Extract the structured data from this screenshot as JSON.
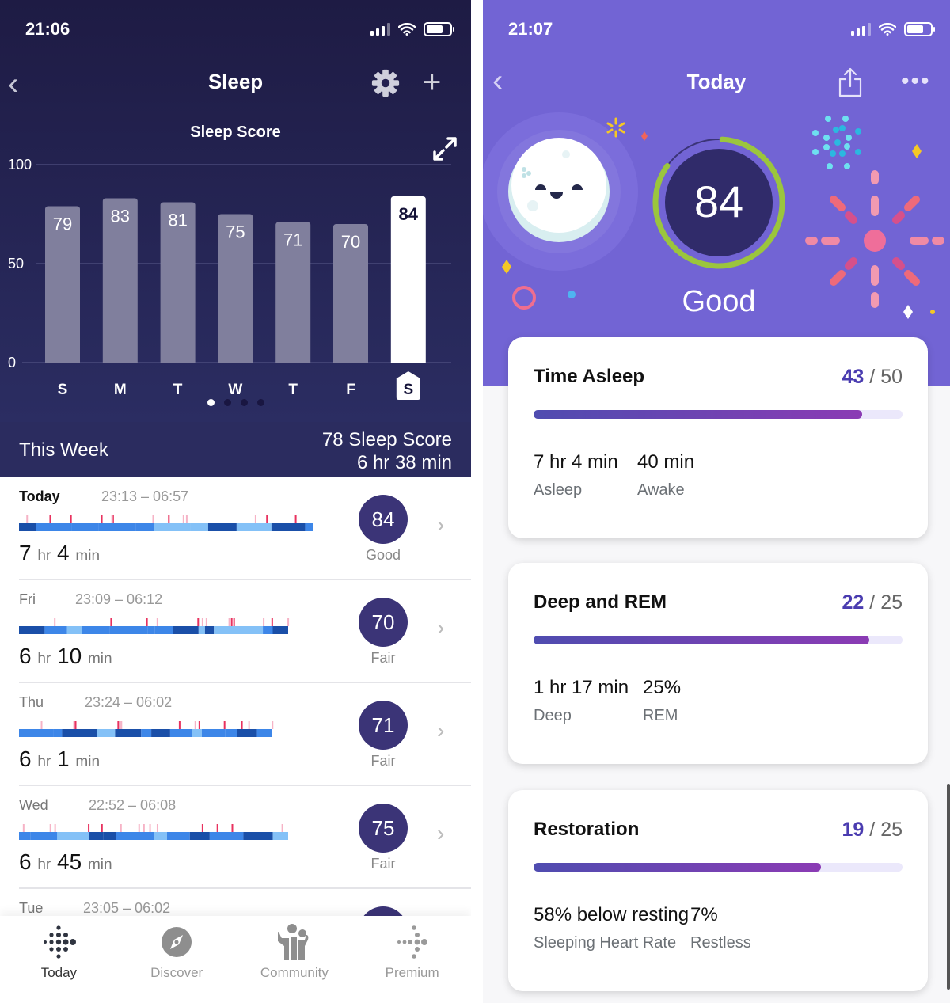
{
  "left": {
    "status": {
      "time": "21:06"
    },
    "nav": {
      "title": "Sleep",
      "back": "‹",
      "plus": "+"
    },
    "chart_title": "Sleep Score",
    "week": {
      "label": "This Week",
      "score": "78 Sleep Score",
      "duration": "6 hr 38 min"
    },
    "rows": [
      {
        "day": "Today",
        "range": "23:13 – 06:57",
        "hours": "7",
        "mins": "4",
        "score": "84",
        "quality": "Good"
      },
      {
        "day": "Fri",
        "range": "23:09 – 06:12",
        "hours": "6",
        "mins": "10",
        "score": "70",
        "quality": "Fair"
      },
      {
        "day": "Thu",
        "range": "23:24 – 06:02",
        "hours": "6",
        "mins": "1",
        "score": "71",
        "quality": "Fair"
      },
      {
        "day": "Wed",
        "range": "22:52 – 06:08",
        "hours": "6",
        "mins": "45",
        "score": "75",
        "quality": "Fair"
      },
      {
        "day": "Tue",
        "range": "23:05 – 06:02",
        "hours": "",
        "mins": "",
        "score": "",
        "quality": ""
      }
    ],
    "hr_unit": "hr",
    "min_unit": "min",
    "tabs": [
      {
        "label": "Today",
        "icon": "fitbit-logo-icon",
        "active": true
      },
      {
        "label": "Discover",
        "icon": "compass-icon",
        "active": false
      },
      {
        "label": "Community",
        "icon": "community-icon",
        "active": false
      },
      {
        "label": "Premium",
        "icon": "premium-icon",
        "active": false
      }
    ]
  },
  "right": {
    "status": {
      "time": "21:07"
    },
    "nav": {
      "title": "Today",
      "back": "‹",
      "more": "•••"
    },
    "score": "84",
    "score_fraction": 0.84,
    "rating": "Good",
    "cards": [
      {
        "title": "Time Asleep",
        "score": "43",
        "max": "/ 50",
        "progress": 0.89,
        "stats": [
          {
            "value": "7 hr 4 min",
            "label": "Asleep"
          },
          {
            "value": "40 min",
            "label": "Awake"
          }
        ]
      },
      {
        "title": "Deep and REM",
        "score": "22",
        "max": "/ 25",
        "progress": 0.91,
        "stats": [
          {
            "value": "1 hr 17 min",
            "label": "Deep"
          },
          {
            "value": "25%",
            "label": "REM"
          }
        ]
      },
      {
        "title": "Restoration",
        "score": "19",
        "max": "/ 25",
        "progress": 0.78,
        "stats": [
          {
            "value": "58% below resting",
            "label": "Sleeping Heart Rate"
          },
          {
            "value": "7%",
            "label": "Restless"
          }
        ]
      }
    ]
  },
  "colors": {
    "left_bg": "#1e1b44",
    "right_bg": "#7264d4",
    "badge": "#3b3477",
    "ring": "#9bc53d",
    "accent": "#4a3cb0"
  },
  "chart_data": {
    "type": "bar",
    "title": "Sleep Score",
    "categories": [
      "S",
      "M",
      "T",
      "W",
      "T",
      "F",
      "S"
    ],
    "values": [
      79,
      83,
      81,
      75,
      71,
      70,
      84
    ],
    "highlighted_index": 6,
    "yticks": [
      0,
      50,
      100
    ],
    "ylim": [
      0,
      100
    ],
    "xlabel": "",
    "ylabel": "",
    "grid": true,
    "pager": {
      "count": 4,
      "active": 0
    }
  }
}
